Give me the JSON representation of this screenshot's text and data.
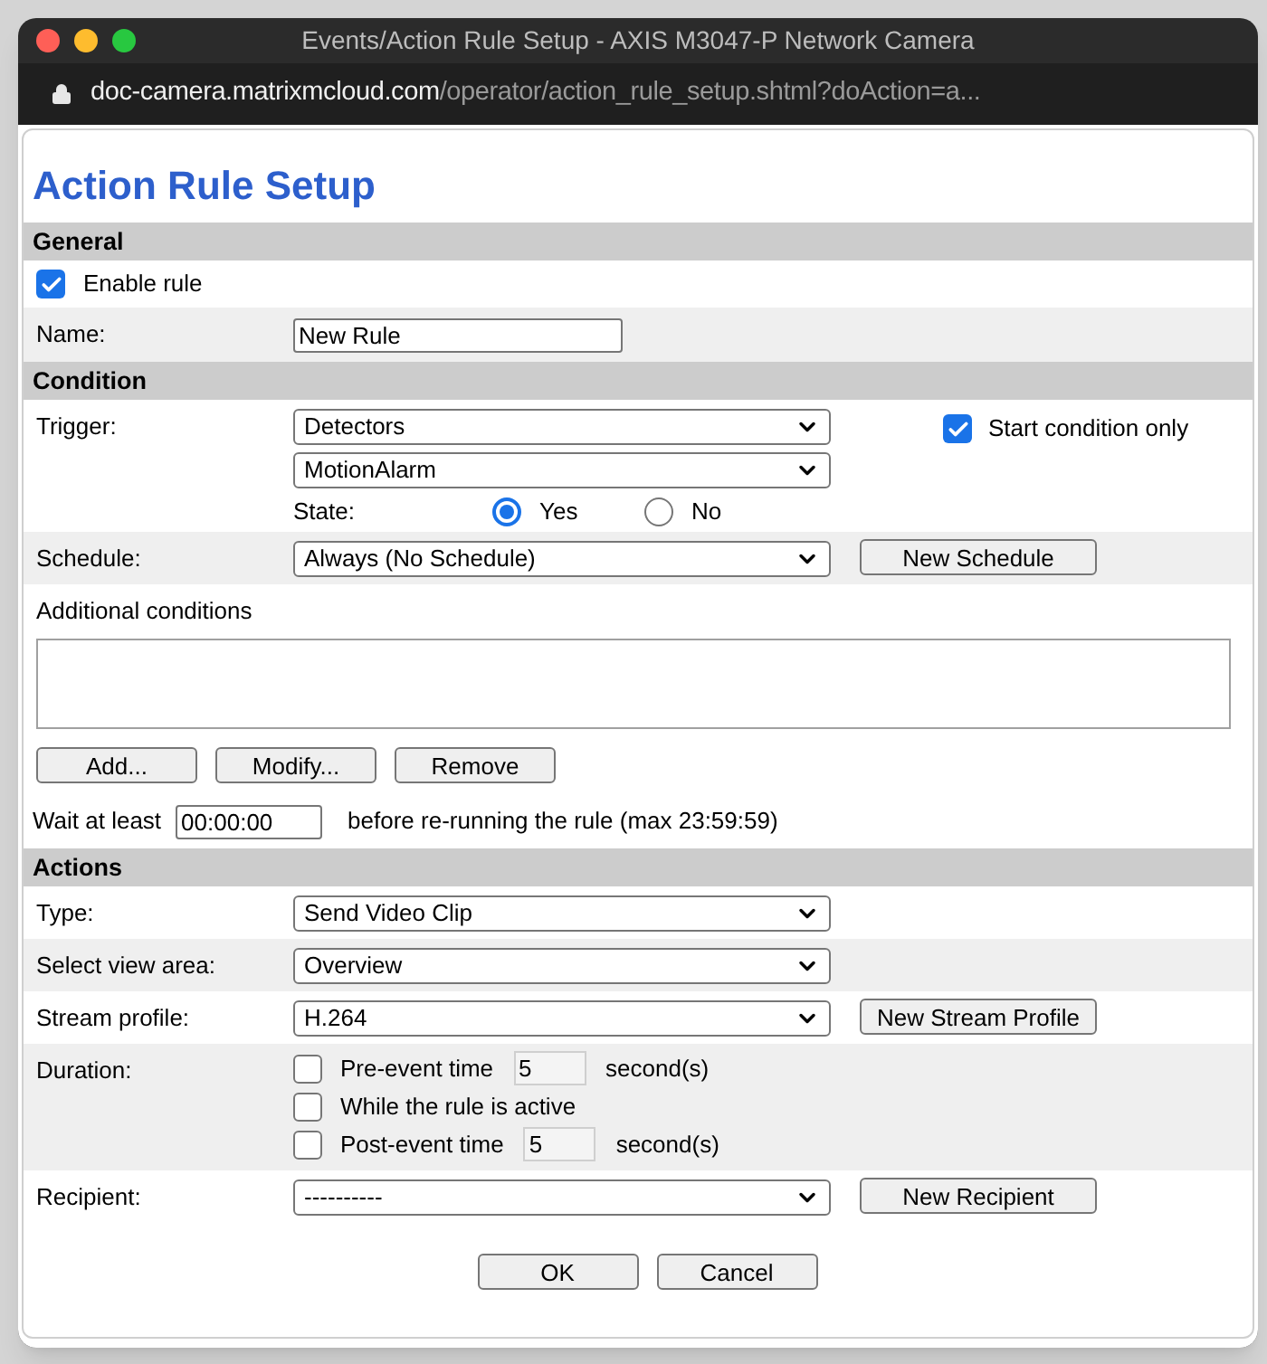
{
  "window": {
    "title": "Events/Action Rule Setup - AXIS M3047-P Network Camera",
    "url_host": "doc-camera.matrixmcloud.com",
    "url_path": "/operator/action_rule_setup.shtml?doAction=a..."
  },
  "page_title": "Action Rule Setup",
  "sections": [
    {
      "title": "General",
      "rows": [
        {
          "kind": "checkbox",
          "label": "Enable rule",
          "checked": true,
          "shaded": false
        },
        {
          "kind": "text",
          "label": "Name:",
          "value": "New Rule",
          "shaded": true
        }
      ]
    },
    {
      "title": "Condition",
      "rows": [
        {
          "kind": "trigger",
          "label": "Trigger:",
          "selects": [
            "Detectors",
            "MotionAlarm"
          ],
          "state_label": "State:",
          "radios": [
            {
              "label": "Yes",
              "selected": true
            },
            {
              "label": "No",
              "selected": false
            }
          ],
          "side_checkbox": {
            "label": "Start condition only",
            "checked": true
          },
          "shaded": false
        },
        {
          "kind": "select",
          "label": "Schedule:",
          "value": "Always (No Schedule)",
          "button": "New Schedule",
          "shaded": true
        },
        {
          "kind": "list",
          "label": "Additional conditions",
          "buttons": [
            "Add...",
            "Modify...",
            "Remove"
          ],
          "shaded": false
        },
        {
          "kind": "wait",
          "label": "Wait at least",
          "value": "00:00:00",
          "suffix": "before re-running the rule (max 23:59:59)",
          "shaded": false
        }
      ]
    },
    {
      "title": "Actions",
      "rows": [
        {
          "kind": "select",
          "label": "Type:",
          "value": "Send Video Clip",
          "shaded": false
        },
        {
          "kind": "select",
          "label": "Select view area:",
          "value": "Overview",
          "shaded": true
        },
        {
          "kind": "select",
          "label": "Stream profile:",
          "value": "H.264",
          "button": "New Stream Profile",
          "shaded": false
        },
        {
          "kind": "duration",
          "label": "Duration:",
          "options": [
            {
              "label": "Pre-event time",
              "checked": false,
              "value": "5",
              "unit": "second(s)"
            },
            {
              "label": "While the rule is active",
              "checked": false
            },
            {
              "label": "Post-event time",
              "checked": false,
              "value": "5",
              "unit": "second(s)"
            }
          ],
          "shaded": true
        },
        {
          "kind": "select",
          "label": "Recipient:",
          "value": "----------",
          "button": "New Recipient",
          "shaded": false
        }
      ]
    }
  ],
  "footer_buttons": [
    "OK",
    "Cancel"
  ]
}
